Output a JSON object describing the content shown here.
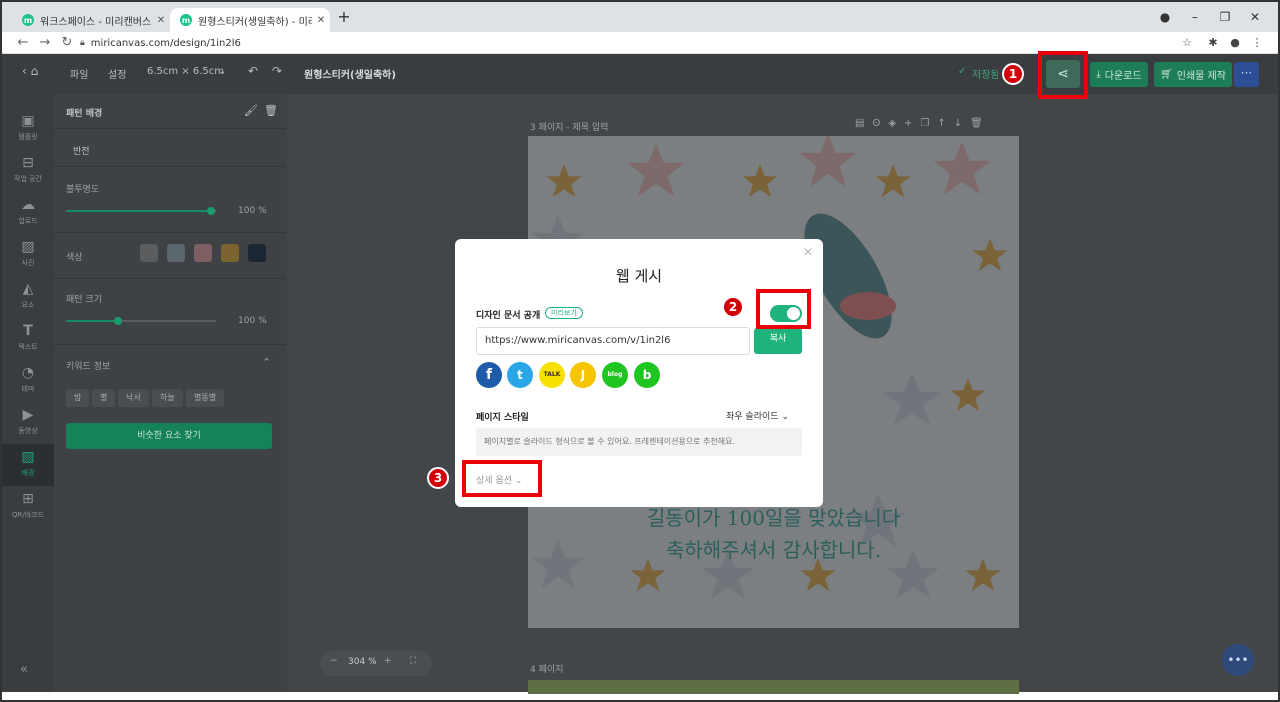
{
  "browser": {
    "tabs": [
      {
        "label": "워크스페이스 - 미리캔버스",
        "active": false
      },
      {
        "label": "원형스티커(생일축하) - 미리캔버",
        "active": true
      }
    ],
    "url": "miricanvas.com/design/1in2l6"
  },
  "toolbar": {
    "file": "파일",
    "settings": "설정",
    "size": "6.5cm × 6.5cm",
    "title": "원형스티커(생일축하)",
    "saved": "저장됨",
    "download": "다운로드",
    "print": "인쇄물 제작"
  },
  "rail": [
    {
      "label": "템플릿",
      "icon": "template-icon"
    },
    {
      "label": "작업 공간",
      "icon": "workspace-icon"
    },
    {
      "label": "업로드",
      "icon": "upload-icon"
    },
    {
      "label": "사진",
      "icon": "photo-icon"
    },
    {
      "label": "요소",
      "icon": "elements-icon"
    },
    {
      "label": "텍스트",
      "icon": "text-icon"
    },
    {
      "label": "테마",
      "icon": "theme-icon"
    },
    {
      "label": "동영상",
      "icon": "video-icon"
    },
    {
      "label": "배경",
      "icon": "background-icon",
      "active": true
    },
    {
      "label": "QR/바코드",
      "icon": "qr-icon"
    }
  ],
  "panel": {
    "title": "패턴 배경",
    "invert": "반전",
    "opacity_label": "불투명도",
    "opacity_value": "100",
    "percent": "%",
    "color_label": "색상",
    "colors": [
      "#f4f4f4",
      "#a9bac4",
      "#e8a1a8",
      "#e6a526",
      "#0e2a47"
    ],
    "pattern_size_label": "패턴 크기",
    "pattern_size_value": "100",
    "keywords_label": "키워드 정보",
    "keywords": [
      "밤",
      "별",
      "낙서",
      "하늘",
      "별똥별"
    ],
    "find_similar": "비슷한 요소 찾기"
  },
  "canvas": {
    "page3_label": "3 페이지",
    "page3_title_placeholder": "제목 입력",
    "phrase_line1": "길동이가 100일을 맞았습니다",
    "phrase_line2": "축하해주셔서 감사합니다.",
    "page4_label": "4 페이지",
    "zoom": "304",
    "zoom_unit": "%"
  },
  "modal": {
    "title": "웹 게시",
    "public_label": "디자인 문서 공개",
    "preview": "미리보기",
    "toggle_on": true,
    "url": "https://www.miricanvas.com/v/1in2l6",
    "copy": "복사",
    "social": [
      {
        "name": "facebook",
        "color": "#1e5ba8",
        "glyph": "f"
      },
      {
        "name": "twitter",
        "color": "#2aa6e6",
        "glyph": "t"
      },
      {
        "name": "kakaotalk",
        "color": "#f6e000",
        "glyph": "TALK"
      },
      {
        "name": "kakaostory",
        "color": "#f6c400",
        "glyph": "J"
      },
      {
        "name": "naver-blog",
        "color": "#1fc41f",
        "glyph": "blog"
      },
      {
        "name": "band",
        "color": "#1fc41f",
        "glyph": "b"
      }
    ],
    "page_style_label": "페이지 스타일",
    "page_style_value": "좌우 슬라이드",
    "page_style_hint": "페이지별로 슬라이드 형식으로 볼 수 있어요. 프레젠테이션용으로 추천해요.",
    "detail_options": "상세 옵션"
  },
  "annotations": {
    "markers": [
      "1",
      "2",
      "3"
    ],
    "color": "#e8000b"
  }
}
